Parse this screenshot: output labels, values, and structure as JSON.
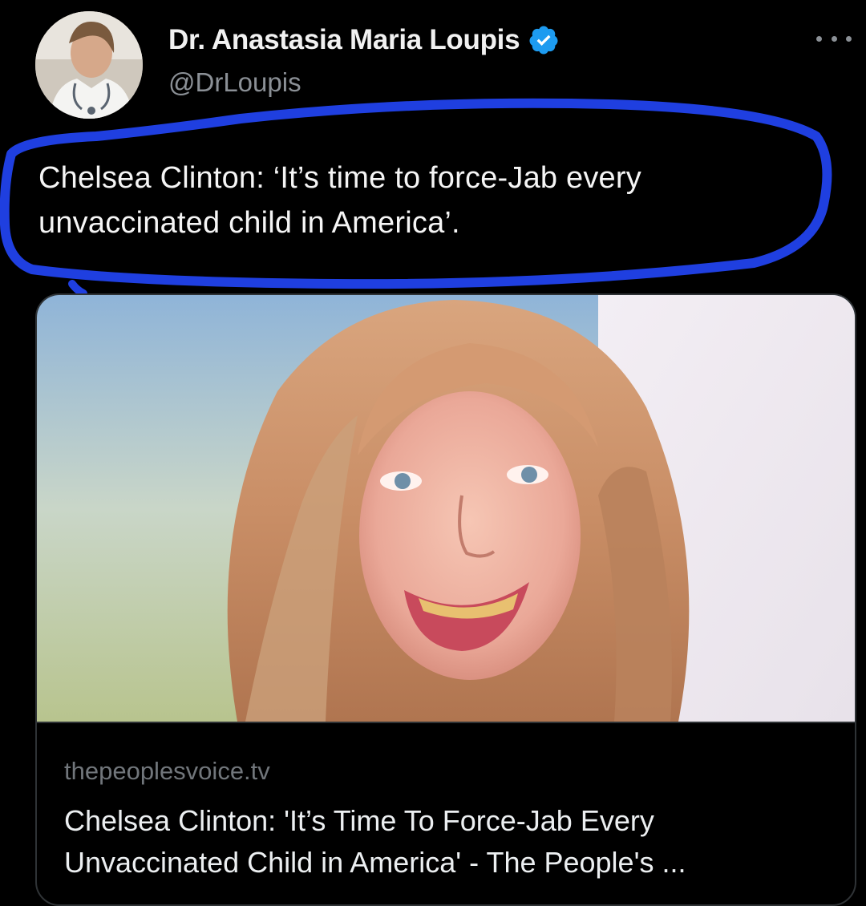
{
  "author": {
    "display_name": "Dr. Anastasia Maria Loupis",
    "handle": "@DrLoupis",
    "verified": true,
    "verified_badge_color": "#1d9bf0"
  },
  "icons": {
    "more": "more-options-icon",
    "verified": "verified-badge-icon"
  },
  "tweet": {
    "text_lines": [
      "Chelsea Clinton: ‘It’s time to force-Jab every",
      "unvaccinated child in America’."
    ],
    "highlight_color": "#1f3fe0"
  },
  "link_card": {
    "domain": "thepeoplesvoice.tv",
    "title_lines": [
      "Chelsea Clinton: 'It’s Time To Force-Jab Every",
      "Unvaccinated Child in America' - The People's ..."
    ]
  },
  "colors": {
    "background": "#000000",
    "text_primary": "#e7e9ea",
    "text_secondary": "#71767b",
    "card_border": "#2f3336"
  }
}
